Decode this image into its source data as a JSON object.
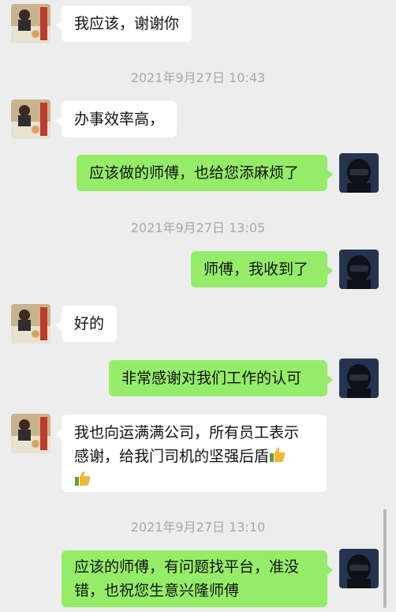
{
  "messages": [
    {
      "text": "我应该，谢谢你"
    },
    {
      "timestamp": "2021年9月27日 10:43"
    },
    {
      "text": "办事效率高，"
    },
    {
      "text": "应该做的师傅，也给您添麻烦了"
    },
    {
      "timestamp": "2021年9月27日 13:05"
    },
    {
      "text": "师傅，我收到了"
    },
    {
      "text": "好的"
    },
    {
      "text": "非常感谢对我们工作的认可"
    },
    {
      "line1": "我也向运满满公司，所有员工表示",
      "line2": "感谢，给我门司机的坚强后盾"
    },
    {
      "timestamp": "2021年9月27日 13:10"
    },
    {
      "line1": "应该的师傅，有问题找平台，准没",
      "line2": "错，也祝您生意兴隆师傅"
    }
  ],
  "colors": {
    "background": "#EDEDED",
    "outgoing_bubble": "#95EC69",
    "incoming_bubble": "#FFFFFF",
    "timestamp": "#A8A8A8"
  },
  "icons": {
    "contact_avatar": "avatar-photo-icon",
    "self_avatar": "helmet-avatar-icon",
    "emoji": "thumbs-up-icon"
  }
}
